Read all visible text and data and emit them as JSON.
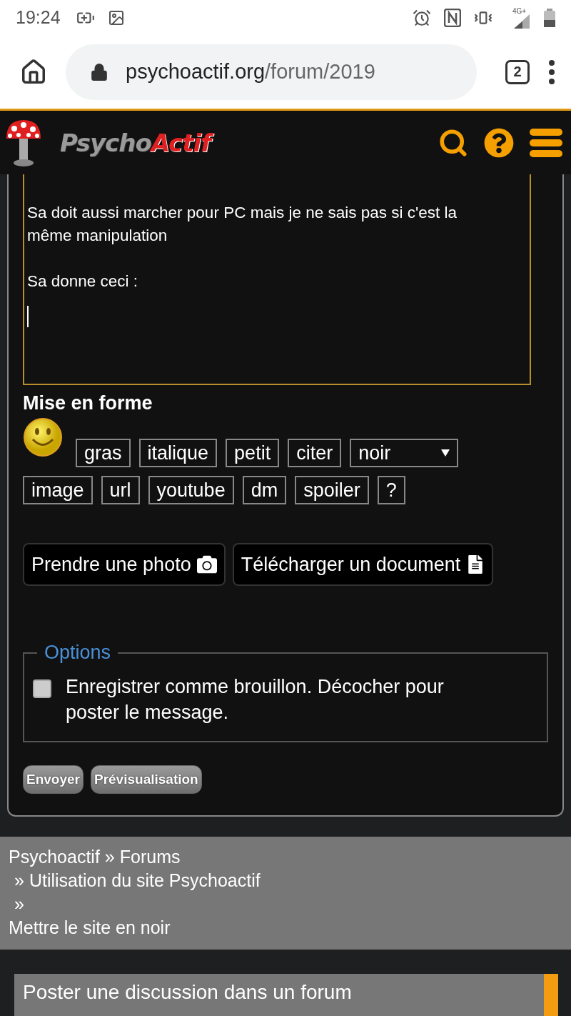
{
  "status_bar": {
    "time": "19:24",
    "network": "4G+"
  },
  "browser": {
    "url_host": "psychoactif.org",
    "url_path": "/forum/2019",
    "tab_count": "2"
  },
  "header": {
    "logo": [
      "Psycho",
      "Actif"
    ]
  },
  "editor": {
    "value": "Sa doit aussi marcher pour PC mais je ne sais pas si c'est la même manipulation\n\nSa donne ceci :\n"
  },
  "formatting": {
    "title": "Mise en forme",
    "buttons": [
      {
        "kind": "button",
        "label": "gras"
      },
      {
        "kind": "button",
        "label": "italique"
      },
      {
        "kind": "button",
        "label": "petit"
      },
      {
        "kind": "button",
        "label": "citer"
      },
      {
        "kind": "select",
        "label": "noir"
      },
      {
        "kind": "button",
        "label": "image"
      },
      {
        "kind": "button",
        "label": "url"
      },
      {
        "kind": "button",
        "label": "youtube"
      },
      {
        "kind": "button",
        "label": "dm"
      },
      {
        "kind": "button",
        "label": "spoiler"
      },
      {
        "kind": "button",
        "label": "?"
      }
    ]
  },
  "uploads": [
    {
      "kind": "camera",
      "label": "Prendre une photo"
    },
    {
      "kind": "document",
      "label": "Télécharger un document"
    }
  ],
  "options": {
    "legend": "Options",
    "draft": {
      "label": "Enregistrer comme brouillon. Décocher pour poster le message.",
      "checked": false
    }
  },
  "actions": [
    "Envoyer",
    "Prévisualisation"
  ],
  "breadcrumb": [
    [
      {
        "kind": "link",
        "text": "Psychoactif"
      },
      {
        "kind": "sep",
        "text": "»"
      },
      {
        "kind": "link",
        "text": "Forums"
      }
    ],
    [
      {
        "kind": "sep",
        "text": "»"
      },
      {
        "kind": "link",
        "text": "Utilisation du site Psychoactif"
      }
    ],
    [
      {
        "kind": "sep",
        "text": "»"
      }
    ],
    [
      {
        "kind": "text",
        "text": "Mettre le site en noir"
      }
    ]
  ],
  "bottom_panel": {
    "title": "Poster une discussion dans un forum"
  }
}
